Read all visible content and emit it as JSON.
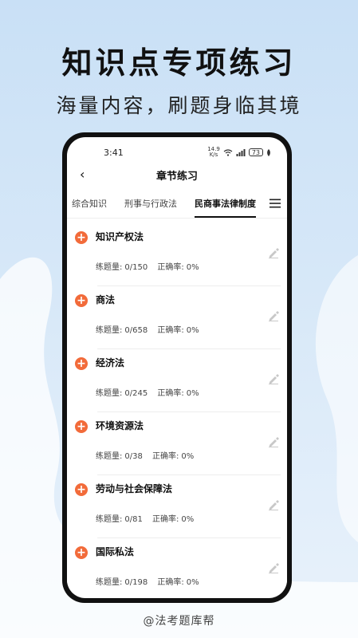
{
  "promo": {
    "headline": "知识点专项练习",
    "subline": "海量内容，刷题身临其境",
    "watermark": "@法考题库帮"
  },
  "status": {
    "time": "3:41",
    "speed": "14.9",
    "speed_unit": "K/s",
    "battery": "73"
  },
  "nav": {
    "title": "章节练习"
  },
  "tabs": [
    "综合知识",
    "刑事与行政法",
    "民商事法律制度"
  ],
  "active_tab": 2,
  "labels": {
    "count": "练题量:",
    "accuracy": "正确率:"
  },
  "chapters": [
    {
      "title": "知识产权法",
      "progress": "0/150",
      "accuracy": "0%"
    },
    {
      "title": "商法",
      "progress": "0/658",
      "accuracy": "0%"
    },
    {
      "title": "经济法",
      "progress": "0/245",
      "accuracy": "0%"
    },
    {
      "title": "环境资源法",
      "progress": "0/38",
      "accuracy": "0%"
    },
    {
      "title": "劳动与社会保障法",
      "progress": "0/81",
      "accuracy": "0%"
    },
    {
      "title": "国际私法",
      "progress": "0/198",
      "accuracy": "0%"
    }
  ],
  "colors": {
    "accent": "#f26b3a",
    "background": "#d3e6f8"
  },
  "icons": [
    "back-icon",
    "menu-icon",
    "plus-icon",
    "edit-icon",
    "wifi-icon",
    "signal-icon",
    "battery-icon"
  ]
}
